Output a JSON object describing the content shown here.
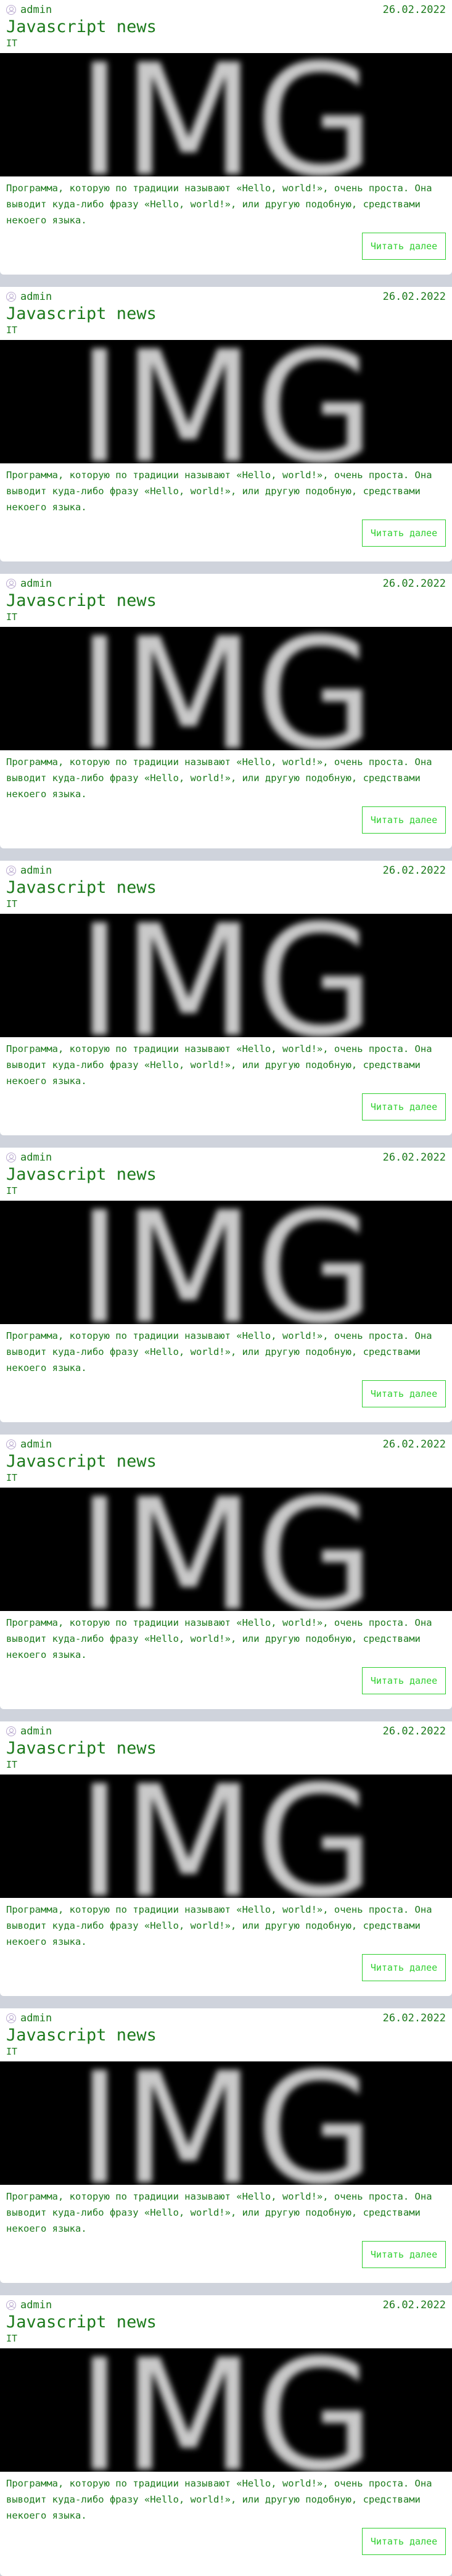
{
  "posts": [
    {
      "author": "admin",
      "date": "26.02.2022",
      "title": "Javascript news",
      "category": "IT",
      "image_text": "IMG",
      "excerpt": "Программа, которую по традиции называют «Hello, world!», очень проста. Она выводит куда-либо фразу «Hello, world!», или другую подобную, средствами некоего языка.",
      "read_more": "Читать далее"
    },
    {
      "author": "admin",
      "date": "26.02.2022",
      "title": "Javascript news",
      "category": "IT",
      "image_text": "IMG",
      "excerpt": "Программа, которую по традиции называют «Hello, world!», очень проста. Она выводит куда-либо фразу «Hello, world!», или другую подобную, средствами некоего языка.",
      "read_more": "Читать далее"
    },
    {
      "author": "admin",
      "date": "26.02.2022",
      "title": "Javascript news",
      "category": "IT",
      "image_text": "IMG",
      "excerpt": "Программа, которую по традиции называют «Hello, world!», очень проста. Она выводит куда-либо фразу «Hello, world!», или другую подобную, средствами некоего языка.",
      "read_more": "Читать далее"
    },
    {
      "author": "admin",
      "date": "26.02.2022",
      "title": "Javascript news",
      "category": "IT",
      "image_text": "IMG",
      "excerpt": "Программа, которую по традиции называют «Hello, world!», очень проста. Она выводит куда-либо фразу «Hello, world!», или другую подобную, средствами некоего языка.",
      "read_more": "Читать далее"
    },
    {
      "author": "admin",
      "date": "26.02.2022",
      "title": "Javascript news",
      "category": "IT",
      "image_text": "IMG",
      "excerpt": "Программа, которую по традиции называют «Hello, world!», очень проста. Она выводит куда-либо фразу «Hello, world!», или другую подобную, средствами некоего языка.",
      "read_more": "Читать далее"
    },
    {
      "author": "admin",
      "date": "26.02.2022",
      "title": "Javascript news",
      "category": "IT",
      "image_text": "IMG",
      "excerpt": "Программа, которую по традиции называют «Hello, world!», очень проста. Она выводит куда-либо фразу «Hello, world!», или другую подобную, средствами некоего языка.",
      "read_more": "Читать далее"
    },
    {
      "author": "admin",
      "date": "26.02.2022",
      "title": "Javascript news",
      "category": "IT",
      "image_text": "IMG",
      "excerpt": "Программа, которую по традиции называют «Hello, world!», очень проста. Она выводит куда-либо фразу «Hello, world!», или другую подобную, средствами некоего языка.",
      "read_more": "Читать далее"
    },
    {
      "author": "admin",
      "date": "26.02.2022",
      "title": "Javascript news",
      "category": "IT",
      "image_text": "IMG",
      "excerpt": "Программа, которую по традиции называют «Hello, world!», очень проста. Она выводит куда-либо фразу «Hello, world!», или другую подобную, средствами некоего языка.",
      "read_more": "Читать далее"
    },
    {
      "author": "admin",
      "date": "26.02.2022",
      "title": "Javascript news",
      "category": "IT",
      "image_text": "IMG",
      "excerpt": "Программа, которую по традиции называют «Hello, world!», очень проста. Она выводит куда-либо фразу «Hello, world!», или другую подобную, средствами некоего языка.",
      "read_more": "Читать далее"
    }
  ],
  "colors": {
    "page_background": "#cfd3dc",
    "card_background": "#ffffff",
    "text_green": "#1b7a1b",
    "button_green": "#2fcf2f",
    "image_background": "#000000"
  },
  "icons": {
    "avatar": "user-avatar-icon"
  }
}
